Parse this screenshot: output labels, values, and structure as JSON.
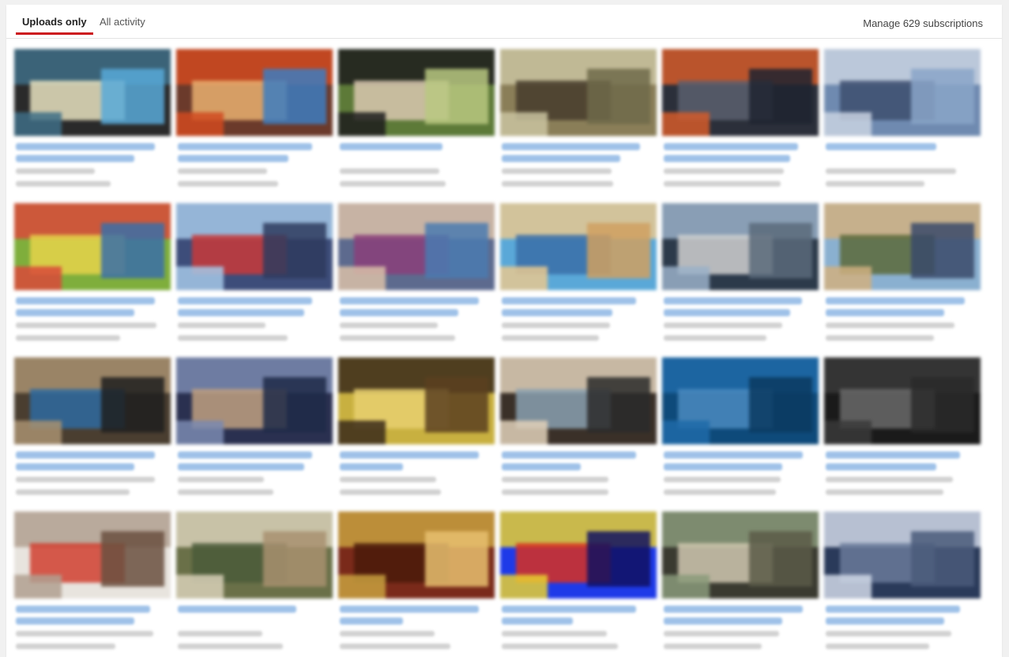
{
  "tabs": [
    {
      "label": "Uploads only",
      "active": true
    },
    {
      "label": "All activity",
      "active": false
    }
  ],
  "manage_label": "Manage 629 subscriptions",
  "accent_color": "#cc181e",
  "link_color": "#4f8fd6",
  "videos_note": "Video titles and metadata are blurred in the original screenshot; 24 video cards shown in a 6x4 grid."
}
